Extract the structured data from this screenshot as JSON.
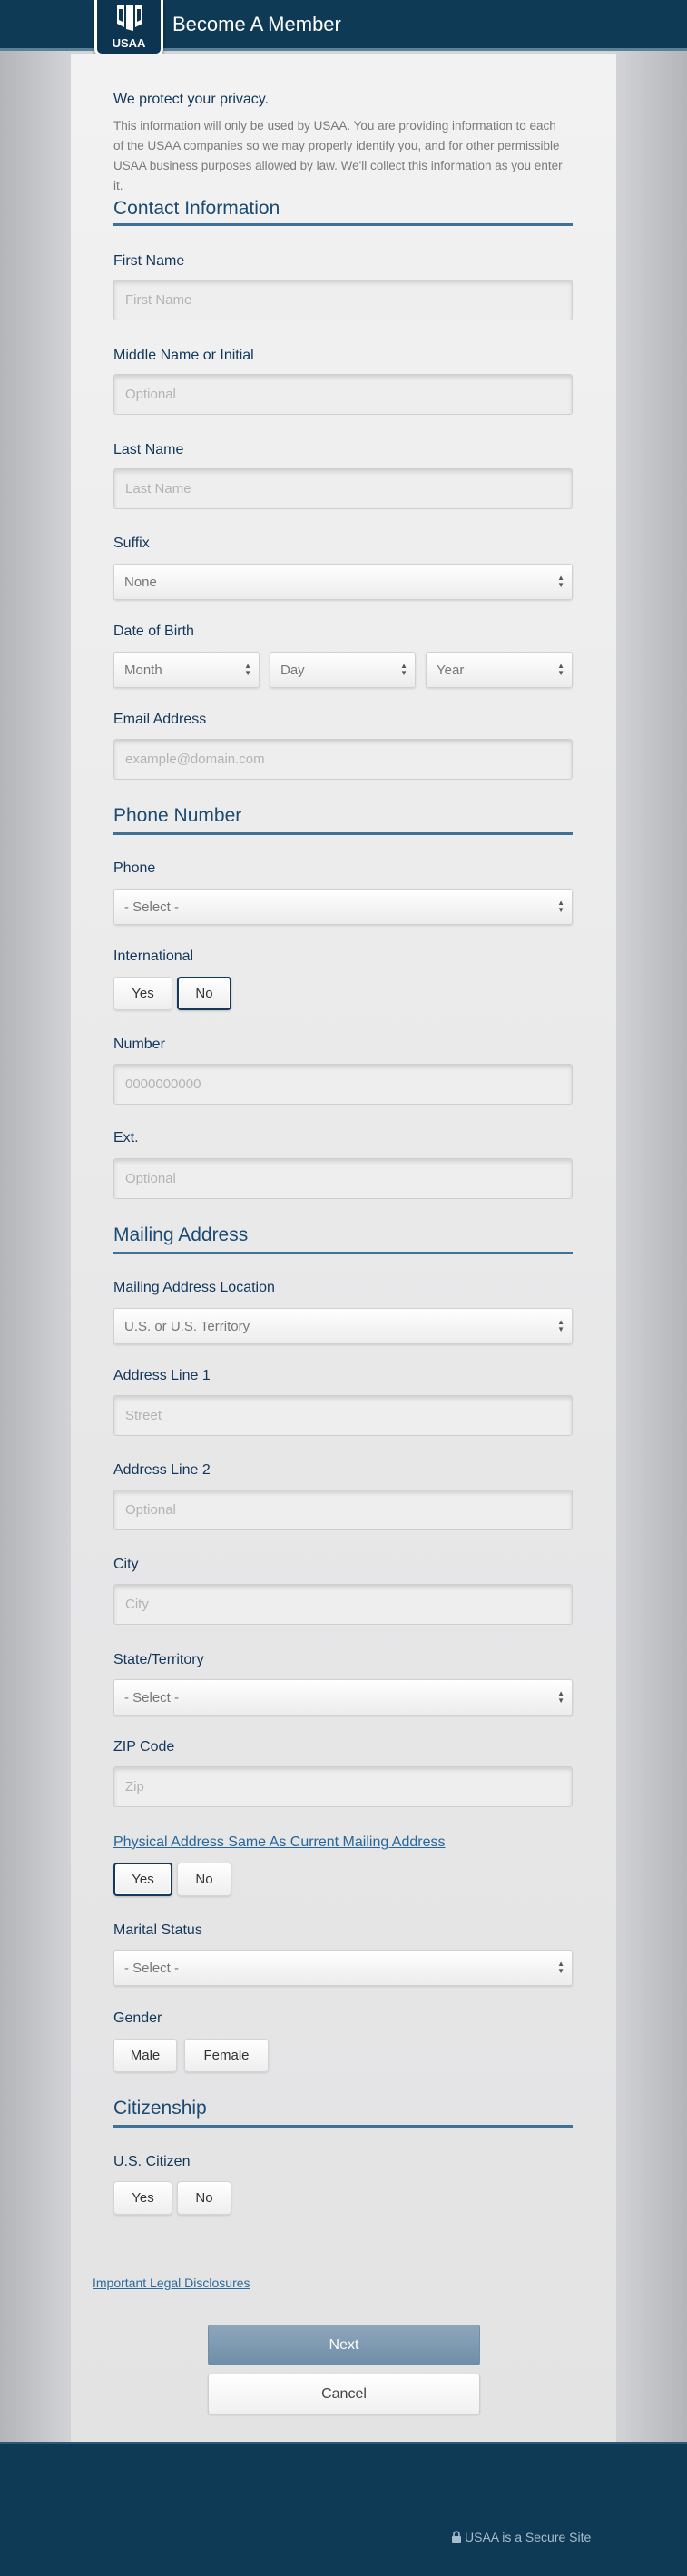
{
  "header": {
    "logo_text": "USAA",
    "title": "Become A Member"
  },
  "privacy": {
    "title": "We protect your privacy.",
    "text": "This information will only be used by USAA. You are providing information to each of the USAA companies so we may properly identify you, and for other permissible USAA business purposes allowed by law. We'll collect this information as you enter it."
  },
  "contact": {
    "section_title": "Contact Information",
    "first_name": {
      "label": "First Name",
      "placeholder": "First Name"
    },
    "middle_name": {
      "label": "Middle Name or Initial",
      "placeholder": "Optional"
    },
    "last_name": {
      "label": "Last Name",
      "placeholder": "Last Name"
    },
    "suffix": {
      "label": "Suffix",
      "value": "None"
    },
    "dob": {
      "label": "Date of Birth",
      "month": "Month",
      "day": "Day",
      "year": "Year"
    },
    "email": {
      "label": "Email Address",
      "placeholder": "example@domain.com"
    }
  },
  "phone": {
    "section_title": "Phone Number",
    "phone": {
      "label": "Phone",
      "value": "- Select -"
    },
    "international": {
      "label": "International",
      "yes": "Yes",
      "no": "No",
      "selected": "No"
    },
    "number": {
      "label": "Number",
      "placeholder": "0000000000"
    },
    "ext": {
      "label": "Ext.",
      "placeholder": "Optional"
    }
  },
  "mailing": {
    "section_title": "Mailing Address",
    "location": {
      "label": "Mailing Address Location",
      "value": "U.S. or U.S. Territory"
    },
    "address1": {
      "label": "Address Line 1",
      "placeholder": "Street"
    },
    "address2": {
      "label": "Address Line 2",
      "placeholder": "Optional"
    },
    "city": {
      "label": "City",
      "placeholder": "City"
    },
    "state": {
      "label": "State/Territory",
      "value": "- Select -"
    },
    "zip": {
      "label": "ZIP Code",
      "placeholder": "Zip"
    },
    "physical_same": {
      "label": "Physical Address Same As Current Mailing Address",
      "yes": "Yes",
      "no": "No",
      "selected": "Yes"
    },
    "marital": {
      "label": "Marital Status",
      "value": "- Select -"
    },
    "gender": {
      "label": "Gender",
      "male": "Male",
      "female": "Female"
    }
  },
  "citizenship": {
    "section_title": "Citizenship",
    "us_citizen": {
      "label": "U.S. Citizen",
      "yes": "Yes",
      "no": "No"
    }
  },
  "footer_links": {
    "legal": "Important Legal Disclosures"
  },
  "actions": {
    "next": "Next",
    "cancel": "Cancel"
  },
  "footer": {
    "secure_text": "USAA is a Secure Site"
  },
  "colors": {
    "brand_navy": "#0f3a55",
    "accent_blue": "#3f7198",
    "next_button": "#7f9bb3"
  }
}
